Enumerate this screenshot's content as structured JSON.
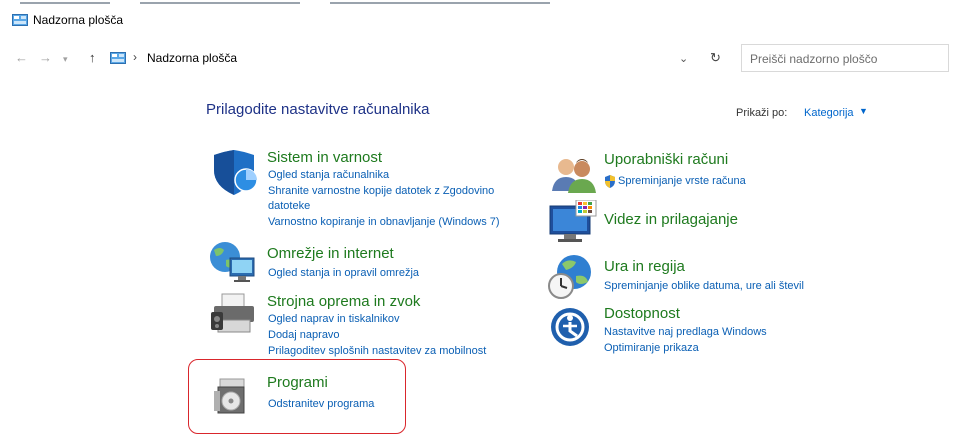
{
  "window": {
    "title": "Nadzorna plošča"
  },
  "nav": {
    "back_icon": "arrow-left-icon",
    "forward_icon": "arrow-right-icon",
    "recent_icon": "chevron-down-icon",
    "up_icon": "arrow-up-icon",
    "address_separator": "›",
    "address": "Nadzorna plošča",
    "search_placeholder": "Preišči nadzorno ploščo"
  },
  "header": {
    "title": "Prilagodite nastavitve računalnika",
    "view_by_label": "Prikaži po:",
    "view_by_value": "Kategorija"
  },
  "categories_left": [
    {
      "title": "Sistem in varnost",
      "icon": "shield-icon",
      "links": [
        "Ogled stanja računalnika",
        "Shranite varnostne kopije datotek z Zgodovino",
        "datoteke",
        "Varnostno kopiranje in obnavljanje (Windows 7)"
      ]
    },
    {
      "title": "Omrežje in internet",
      "icon": "network-icon",
      "links": [
        "Ogled stanja in opravil omrežja"
      ]
    },
    {
      "title": "Strojna oprema in zvok",
      "icon": "printer-icon",
      "links": [
        "Ogled naprav in tiskalnikov",
        "Dodaj napravo",
        "Prilagoditev splošnih nastavitev za mobilnost"
      ]
    },
    {
      "title": "Programi",
      "icon": "programs-icon",
      "links": [
        "Odstranitev programa"
      ]
    }
  ],
  "categories_right": [
    {
      "title": "Uporabniški računi",
      "icon": "users-icon",
      "links": [
        "Spreminjanje vrste računa"
      ]
    },
    {
      "title": "Videz in prilagajanje",
      "icon": "display-icon",
      "links": []
    },
    {
      "title": "Ura in regija",
      "icon": "clock-globe-icon",
      "links": [
        "Spreminjanje oblike datuma, ure ali števil"
      ]
    },
    {
      "title": "Dostopnost",
      "icon": "accessibility-icon",
      "links": [
        "Nastavitve naj predlaga Windows",
        "Optimiranje prikaza"
      ]
    }
  ],
  "colors": {
    "category_title": "#1e7a1e",
    "link": "#0a5fb4",
    "page_title": "#1e3287",
    "highlight": "#d9262c"
  }
}
